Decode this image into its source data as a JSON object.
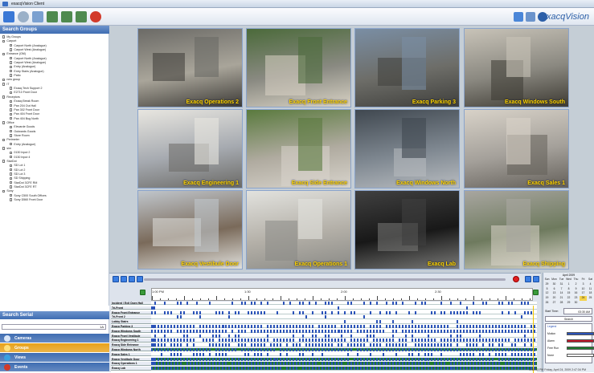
{
  "window": {
    "title": "exacqVision Client"
  },
  "brand": {
    "name": "exacqVision"
  },
  "sidebar": {
    "search_groups_title": "Search Groups",
    "tree": [
      {
        "l": 0,
        "t": "My Groups"
      },
      {
        "l": 0,
        "t": "Carport"
      },
      {
        "l": 1,
        "t": "Carport North (Analogue)"
      },
      {
        "l": 1,
        "t": "Carport West (Analogue)"
      },
      {
        "l": 0,
        "t": "Entrance (GM)"
      },
      {
        "l": 1,
        "t": "Carport North (Analogue)"
      },
      {
        "l": 1,
        "t": "Carport West (Analogue)"
      },
      {
        "l": 1,
        "t": "Entry (Analogue)"
      },
      {
        "l": 1,
        "t": "Entry Stairs (Analogue)"
      },
      {
        "l": 1,
        "t": "Patio"
      },
      {
        "l": 0,
        "t": "new group"
      },
      {
        "l": 0,
        "t": "IT"
      },
      {
        "l": 1,
        "t": "Exacq Tech Support 2"
      },
      {
        "l": 1,
        "t": "E2710 Front Door"
      },
      {
        "l": 0,
        "t": "Receptors"
      },
      {
        "l": 1,
        "t": "Exacq Break Room"
      },
      {
        "l": 1,
        "t": "Pan 204 Out Hall"
      },
      {
        "l": 1,
        "t": "Pan 302 Front Door"
      },
      {
        "l": 1,
        "t": "Pan 404 Front Door"
      },
      {
        "l": 1,
        "t": "Pan 404 Bug North"
      },
      {
        "l": 0,
        "t": "Office"
      },
      {
        "l": 1,
        "t": "Elevarde Goods"
      },
      {
        "l": 1,
        "t": "Outwards Goods"
      },
      {
        "l": 1,
        "t": "Store Room"
      },
      {
        "l": 0,
        "t": "Perimeter"
      },
      {
        "l": 1,
        "t": "Entry (Analogue)"
      },
      {
        "l": 0,
        "t": "sim"
      },
      {
        "l": 1,
        "t": "0130 Input 2"
      },
      {
        "l": 1,
        "t": "0130 Input 4"
      },
      {
        "l": 0,
        "t": "StarDot"
      },
      {
        "l": 1,
        "t": "SD Lot 1"
      },
      {
        "l": 1,
        "t": "SD Lot 2"
      },
      {
        "l": 1,
        "t": "SD Lot 3"
      },
      {
        "l": 1,
        "t": "SD Shipping"
      },
      {
        "l": 1,
        "t": "StarDot 3CFE RM"
      },
      {
        "l": 1,
        "t": "StarDot 3CFE RT"
      },
      {
        "l": 0,
        "t": "Sony"
      },
      {
        "l": 1,
        "t": "Sony C500 South Offices"
      },
      {
        "l": 1,
        "t": "Sony D560 Front Door"
      }
    ],
    "search_serial_title": "Search Serial",
    "serial_value": "1A",
    "nav": [
      {
        "label": "Cameras",
        "color": "#3f6db2",
        "icon": "#d9e6f7"
      },
      {
        "label": "Groups",
        "color": "#e8a21a",
        "icon": "#ffe07a"
      },
      {
        "label": "Views",
        "color": "#3f6db2",
        "icon": "#3aa0e0"
      },
      {
        "label": "Events",
        "color": "#3f6db2",
        "icon": "#d23a2a"
      }
    ]
  },
  "cameras": [
    {
      "name": "Exacq Operations 2"
    },
    {
      "name": "Exacq Front Entrance"
    },
    {
      "name": "Exacq Parking 3"
    },
    {
      "name": "Exacq Windows South"
    },
    {
      "name": "Exacq Engineering 1"
    },
    {
      "name": "Exacq Side Entrance"
    },
    {
      "name": "Exacq Windows North"
    },
    {
      "name": "Exacq Sales 1"
    },
    {
      "name": "Exacq Vestibule Door"
    },
    {
      "name": "Exacq Operations 1"
    },
    {
      "name": "Exacq Lab"
    },
    {
      "name": "Exacq Shipping"
    }
  ],
  "timeline": {
    "ticks": [
      "1:00 PM",
      "1:30",
      "2:00",
      "2:30"
    ],
    "tracks": [
      "Incident / Exit Open Hall",
      "Tri-Front",
      "Exacq Front Entrance",
      "Tri-Front 2",
      "Lobby Stairs",
      "Exacq Parking 3",
      "Exacq Windows South",
      "Exacq Front Vestibule",
      "Exacq Engineering 1",
      "Exacq Side Entrance",
      "Exacq Windows North",
      "Exacq Sales 1",
      "Exacq Vestibule Door",
      "Exacq Operations 1",
      "Exacq Lab"
    ]
  },
  "calendar": {
    "month": "April 2009",
    "days": [
      "Sun",
      "Mon",
      "Tue",
      "Wed",
      "Thu",
      "Fri",
      "Sat"
    ],
    "weeks": [
      [
        "29",
        "30",
        "31",
        "1",
        "2",
        "3",
        "4"
      ],
      [
        "5",
        "6",
        "7",
        "8",
        "9",
        "10",
        "11"
      ],
      [
        "12",
        "13",
        "14",
        "15",
        "16",
        "17",
        "18"
      ],
      [
        "19",
        "20",
        "21",
        "22",
        "23",
        "24",
        "25"
      ],
      [
        "26",
        "27",
        "28",
        "29",
        "30",
        "",
        ""
      ]
    ],
    "start_time_label": "Start Time:",
    "start_time": "03:30 AM",
    "search_label": "Search",
    "legend_title": "Legend",
    "legend": [
      {
        "label": "Motion",
        "color": "#2a52b8"
      },
      {
        "label": "Alarm",
        "color": "#c0182a"
      },
      {
        "label": "Free Run",
        "color": "#1f7a2e"
      },
      {
        "label": "None",
        "color": "#ffffff"
      }
    ]
  },
  "status": {
    "text": "2:40:03 PM     Friday, April 24, 2009     2:47:34 PM"
  }
}
